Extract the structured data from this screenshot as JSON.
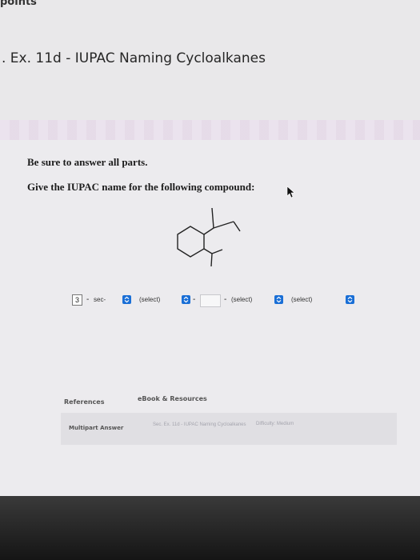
{
  "header": {
    "top_text": "points",
    "title": ". Ex. 11d - IUPAC Naming Cycloalkanes"
  },
  "question": {
    "instruction": "Be sure to answer all parts.",
    "prompt": "Give the IUPAC name for the following compound:"
  },
  "answer": {
    "locant_value": "3",
    "dash": "-",
    "prefix_select": "sec-",
    "select_2": "(select)",
    "select_3": "(select)",
    "select_4": "(select)",
    "chevron_color": "#1a6fd6"
  },
  "footer": {
    "references_tab": "References",
    "ebook_tab": "eBook & Resources",
    "answer_type_label": "Multipart Answer",
    "section_text": "Sec. Ex. 11d - IUPAC Naming Cycloalkanes",
    "difficulty_text": "Difficulty: Medium"
  },
  "icons": {
    "cursor": "mouse-pointer-icon",
    "select_chevron": "chevron-up-down-icon"
  }
}
